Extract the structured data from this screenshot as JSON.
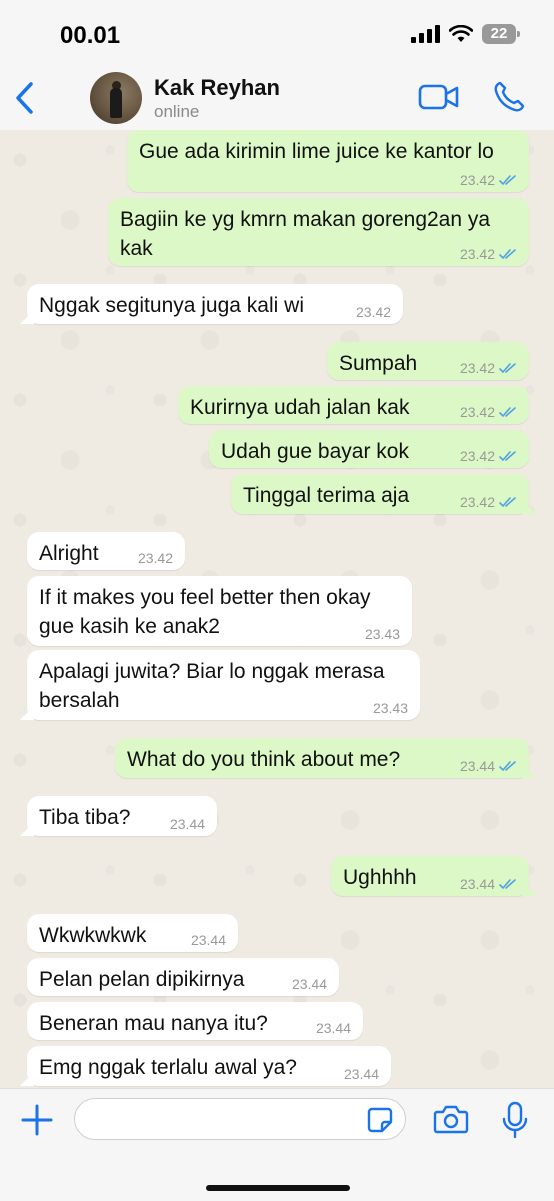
{
  "status_bar": {
    "time": "00.01",
    "battery": "22"
  },
  "header": {
    "contact_name": "Kak Reyhan",
    "contact_status": "online"
  },
  "messages": [
    {
      "dir": "out",
      "text": "Gue ada kirimin lime juice ke kantor lo",
      "time": "23.42"
    },
    {
      "dir": "out",
      "text": "Bagiin ke yg kmrn makan goreng2an ya kak",
      "time": "23.42"
    },
    {
      "dir": "in",
      "text": "Nggak segitunya juga kali wi",
      "time": "23.42"
    },
    {
      "dir": "out",
      "text": "Sumpah",
      "time": "23.42"
    },
    {
      "dir": "out",
      "text": "Kurirnya udah jalan kak",
      "time": "23.42"
    },
    {
      "dir": "out",
      "text": "Udah gue bayar kok",
      "time": "23.42"
    },
    {
      "dir": "out",
      "text": "Tinggal terima aja",
      "time": "23.42"
    },
    {
      "dir": "in",
      "text": "Alright",
      "time": "23.42"
    },
    {
      "dir": "in",
      "text": "If it makes you feel better then okay gue kasih ke anak2",
      "time": "23.43"
    },
    {
      "dir": "in",
      "text": "Apalagi juwita? Biar lo nggak merasa bersalah",
      "time": "23.43"
    },
    {
      "dir": "out",
      "text": "What do you think about me?",
      "time": "23.44"
    },
    {
      "dir": "in",
      "text": "Tiba tiba?",
      "time": "23.44"
    },
    {
      "dir": "out",
      "text": "Ughhhh",
      "time": "23.44"
    },
    {
      "dir": "in",
      "text": "Wkwkwkwk",
      "time": "23.44"
    },
    {
      "dir": "in",
      "text": "Pelan pelan dipikirnya",
      "time": "23.44"
    },
    {
      "dir": "in",
      "text": "Beneran mau nanya itu?",
      "time": "23.44"
    },
    {
      "dir": "in",
      "text": "Emg nggak terlalu awal ya?",
      "time": "23.44"
    }
  ],
  "input": {
    "value": "",
    "placeholder": ""
  },
  "colors": {
    "accent": "#1a73e8",
    "outgoing": "#dcf8c6",
    "incoming": "#ffffff",
    "read_ticks": "#4fa3e0"
  },
  "icons": [
    "back-icon",
    "video-call-icon",
    "phone-icon",
    "plus-icon",
    "sticker-icon",
    "camera-icon",
    "microphone-icon",
    "read-ticks-icon"
  ]
}
